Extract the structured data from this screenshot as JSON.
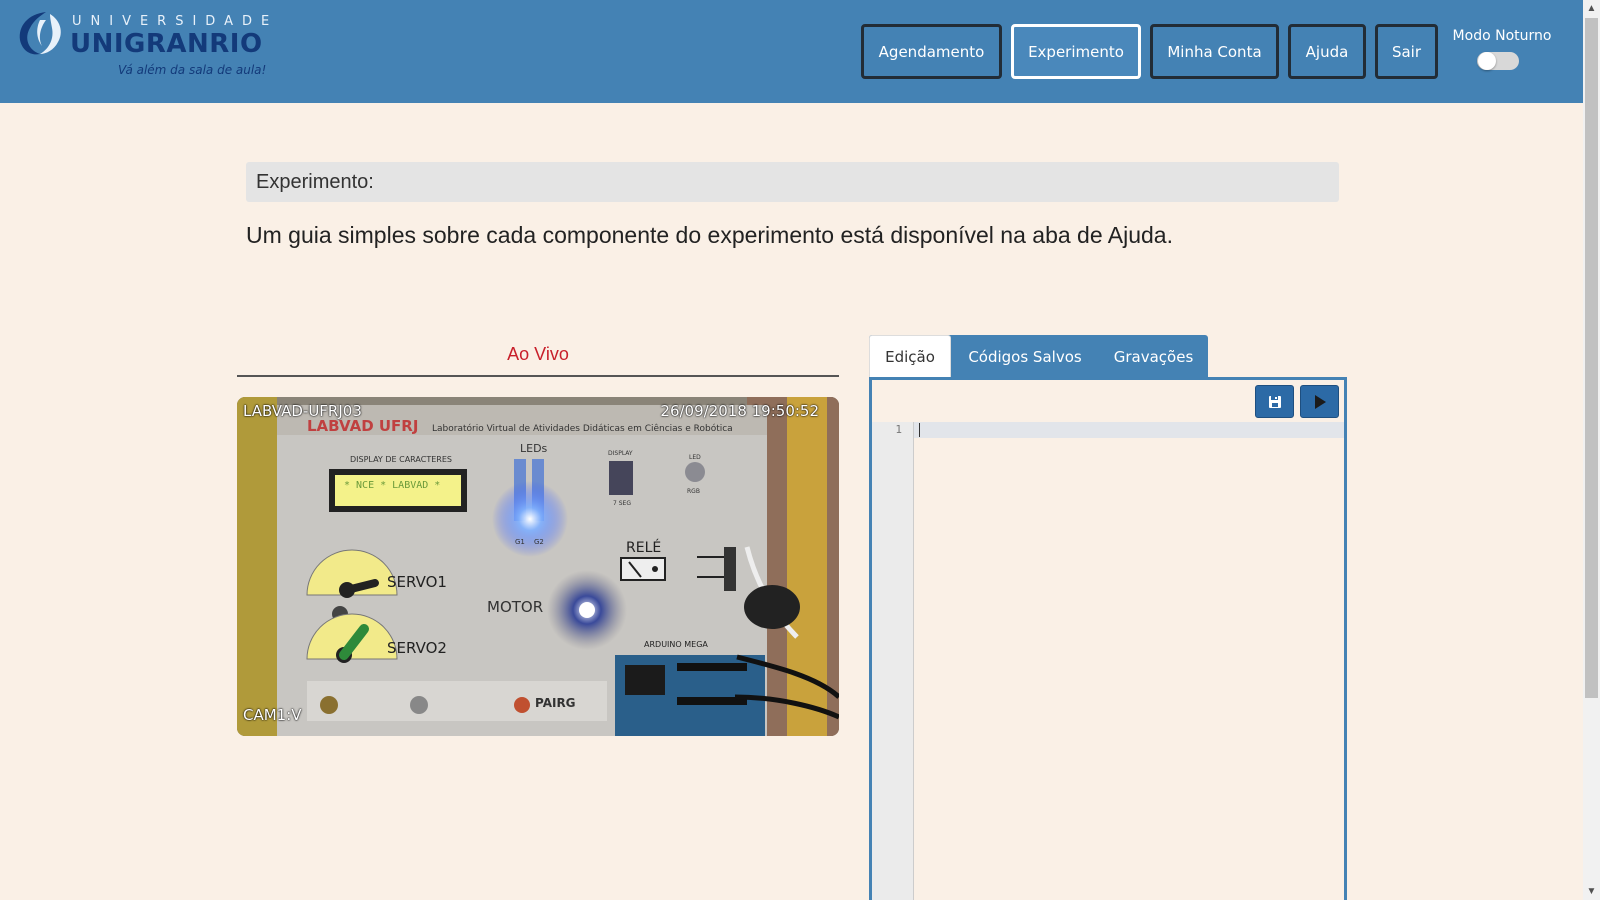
{
  "brand": {
    "top_text": "UNIVERSIDADE",
    "name": "UNIGRANRIO",
    "tagline": "Vá além da sala de aula!"
  },
  "nav": {
    "items": [
      {
        "label": "Agendamento",
        "active": false
      },
      {
        "label": "Experimento",
        "active": true
      },
      {
        "label": "Minha Conta",
        "active": false
      },
      {
        "label": "Ajuda",
        "active": false
      },
      {
        "label": "Sair",
        "active": false
      }
    ],
    "night_mode_label": "Modo Noturno",
    "night_mode_on": false
  },
  "page": {
    "section_title": "Experimento:",
    "intro": "Um guia simples sobre cada componente do experimento está disponível na aba de Ajuda."
  },
  "live": {
    "title": "Ao Vivo",
    "camera_name": "LABVAD-UFRJ03",
    "timestamp": "26/09/2018 19:50:52",
    "camera_id": "CAM1:V",
    "board": {
      "header": "LABVAD UFRJ",
      "header_sub": "Laboratório Virtual de Atividades Didáticas em Ciências e Robótica",
      "display_label": "DISPLAY DE CARACTERES",
      "display_text": "* NCE * LABVAD *",
      "leds_label": "LEDs",
      "led_names": [
        "G1",
        "G2"
      ],
      "seg_label": "DISPLAY",
      "seg_sub": "7 SEG",
      "led_rgb_label": "LED",
      "led_rgb_sub": "RGB",
      "rele_label": "RELÉ",
      "servo1_label": "SERVO1",
      "servo2_label": "SERVO2",
      "motor_label": "MOTOR",
      "arduino_label": "ARDUINO MEGA",
      "pairg_label": "PAIRG"
    }
  },
  "editor": {
    "tabs": [
      {
        "label": "Edição",
        "active": true
      },
      {
        "label": "Códigos Salvos",
        "active": false
      },
      {
        "label": "Gravações",
        "active": false
      }
    ],
    "line_numbers": [
      "1"
    ],
    "save_icon": "floppy-icon",
    "run_icon": "play-icon"
  },
  "colors": {
    "header": "#4482b4",
    "background": "#faf0e6",
    "live_title": "#c8202b",
    "button_dark": "#2c6aa6"
  }
}
